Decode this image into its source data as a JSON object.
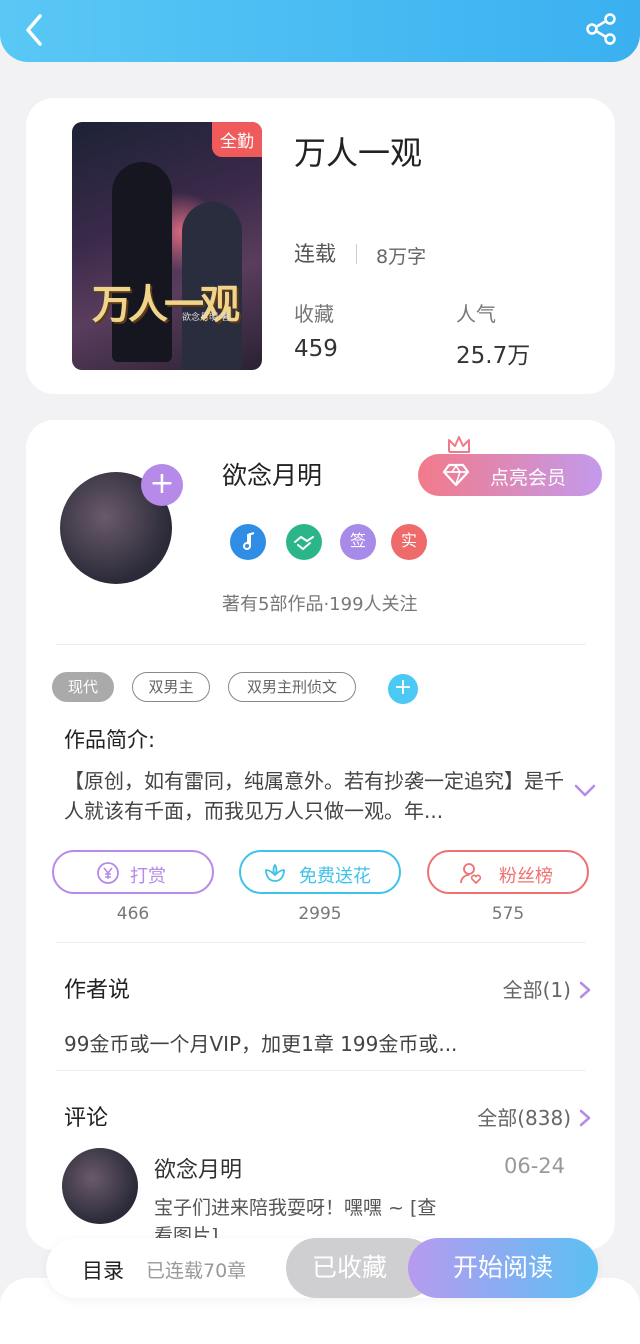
{
  "book": {
    "title": "万人一观",
    "cover_badge": "全勤",
    "cover_title_art": "万人一观",
    "cover_author_art": "欲念月明.著",
    "status": "连载",
    "words": "8万字",
    "stats": [
      {
        "label": "收藏",
        "value": "459"
      },
      {
        "label": "人气",
        "value": "25.7万"
      }
    ]
  },
  "author": {
    "name": "欲念月明",
    "vip_label": "点亮会员",
    "follow_symbol": "+",
    "medals": [
      {
        "name": "music-medal",
        "text": "",
        "color": "#2f8de6"
      },
      {
        "name": "handshake-medal",
        "text": "",
        "color": "#2bb58a"
      },
      {
        "name": "sign-medal",
        "text": "签",
        "color": "#a88ae8"
      },
      {
        "name": "real-medal",
        "text": "实",
        "color": "#ef6a6a"
      }
    ],
    "meta": "著有5部作品·199人关注"
  },
  "tags": [
    "现代",
    "双男主",
    "双男主刑侦文"
  ],
  "tag_add_symbol": "+",
  "intro": {
    "title": "作品简介:",
    "text": "【原创，如有雷同，纯属意外。若有抄袭一定追究】是千人就该有千面，而我见万人只做一观。年..."
  },
  "actions": [
    {
      "label": "打赏",
      "count": "466",
      "color": "#b58ae8"
    },
    {
      "label": "免费送花",
      "count": "2995",
      "color": "#3ec3e8"
    },
    {
      "label": "粉丝榜",
      "count": "575",
      "color": "#ee7070"
    }
  ],
  "author_says": {
    "title": "作者说",
    "more": "全部(1)",
    "text": "99金币或一个月VIP，加更1章 199金币或..."
  },
  "comments": {
    "title": "评论",
    "more": "全部(838)",
    "items": [
      {
        "name": "欲念月明",
        "date": "06-24",
        "text": "宝子们进来陪我耍呀！嘿嘿 ~ [查看图片]"
      }
    ]
  },
  "bottom": {
    "toc": "目录",
    "chapters": "已连载70章",
    "fav": "已收藏",
    "read": "开始阅读"
  },
  "colors": {
    "accent": "#3ab0f0",
    "vip": "#f27a8a"
  }
}
